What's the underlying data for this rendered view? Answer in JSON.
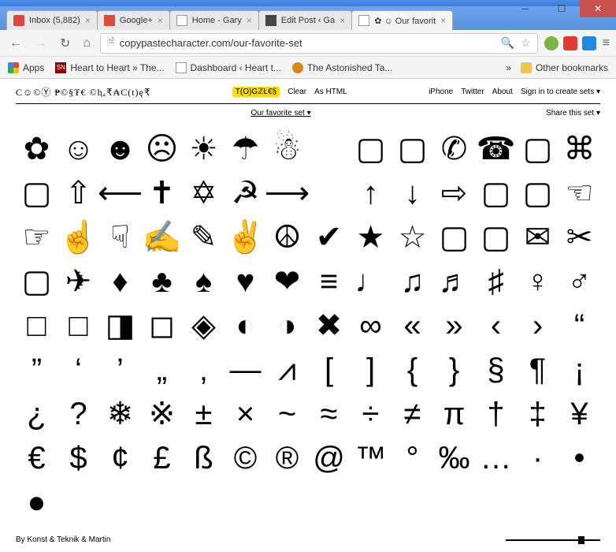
{
  "window": {
    "tabs": [
      {
        "title": "Inbox (5,882)",
        "icon": "gmail"
      },
      {
        "title": "Google+",
        "icon": "gplus"
      },
      {
        "title": "Home - Gary",
        "icon": "page"
      },
      {
        "title": "Edit Post ‹ Ga",
        "icon": "wp"
      },
      {
        "title": "✿ ☺ Our favorit",
        "icon": "page",
        "active": true
      }
    ],
    "url": "copypastecharacter.com/our-favorite-set"
  },
  "bookmarks": {
    "apps": "Apps",
    "items": [
      {
        "label": "Heart to Heart » The...",
        "icon": "sn"
      },
      {
        "label": "Dashboard ‹ Heart t...",
        "icon": "dash"
      },
      {
        "label": "The Astonished Ta...",
        "icon": "ast"
      }
    ],
    "more": "»",
    "other": "Other bookmarks"
  },
  "page": {
    "logo": "C☺©Ⓨ ₱©§₮€ ©ⱨₐ₹₳C(t)ę₹",
    "toggles": "T(O)GℤŁ€§",
    "clear": "Clear",
    "ashtml": "As HTML",
    "nav": [
      "iPhone",
      "Twitter",
      "About",
      "Sign in to create sets ▾"
    ],
    "favset": "Our favorite set ▾",
    "share": "Share this set ▾",
    "footer": "By Konst & Teknik & Martin"
  },
  "chars": [
    "✿",
    "☺",
    "☻",
    "☹",
    "☀",
    "☂",
    "☃",
    "",
    "▢",
    "▢",
    "✆",
    "☎",
    "▢",
    "⌘",
    "▢",
    "⇧",
    "⟵",
    "✝",
    "✡",
    "☭",
    "⟶",
    "",
    "↑",
    "↓",
    "⇨",
    "▢",
    "▢",
    "☜",
    "☞",
    "☝",
    "☟",
    "✍",
    "✎",
    "✌",
    "☮",
    "✔",
    "★",
    "☆",
    "▢",
    "▢",
    "✉",
    "✂",
    "▢",
    "✈",
    "♦",
    "♣",
    "♠",
    "♥",
    "❤",
    "≡",
    "♩",
    "♫",
    "♬",
    "♯",
    "♀",
    "♂",
    "□",
    "□",
    "◨",
    "◻",
    "◈",
    "◐",
    "◑",
    "✖",
    "∞",
    "«",
    "»",
    "‹",
    "›",
    "“",
    "”",
    "‘",
    "’",
    "„",
    "‚",
    "—",
    "⩘",
    "[",
    "]",
    "{",
    "}",
    "§",
    "¶",
    "¡",
    "¿",
    "?",
    "❄",
    "※",
    "±",
    "×",
    "~",
    "≈",
    "÷",
    "≠",
    "π",
    "†",
    "‡",
    "¥",
    "€",
    "$",
    "¢",
    "£",
    "ß",
    "©",
    "®",
    "@",
    "™",
    "°",
    "‰",
    "…",
    "·",
    "•",
    "●"
  ]
}
